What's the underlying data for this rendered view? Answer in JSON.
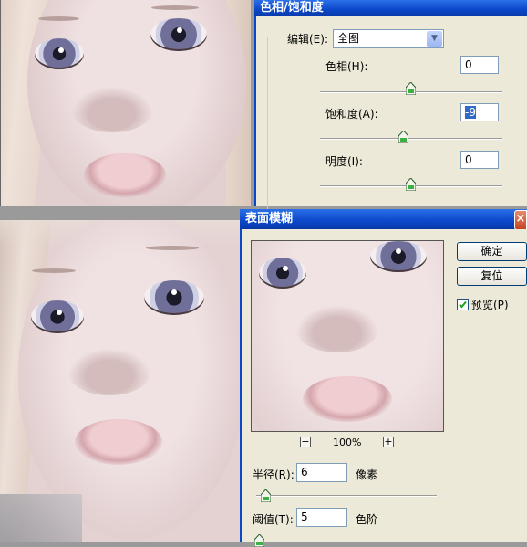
{
  "hue_sat_dialog": {
    "title": "色相/饱和度",
    "edit_label": "编辑(E):",
    "edit_value": "全图",
    "hue_label": "色相(H):",
    "hue_value": "0",
    "saturation_label": "饱和度(A):",
    "saturation_value": "-9",
    "lightness_label": "明度(I):",
    "lightness_value": "0"
  },
  "surface_blur_dialog": {
    "title": "表面模糊",
    "ok_label": "确定",
    "reset_label": "复位",
    "preview_label": "预览(P)",
    "preview_checked": true,
    "zoom_out_label": "−",
    "zoom_in_label": "+",
    "zoom_level": "100%",
    "radius_label": "半径(R):",
    "radius_value": "6",
    "radius_unit": "像素",
    "threshold_label": "阈值(T):",
    "threshold_value": "5",
    "threshold_unit": "色阶",
    "close_label": "×"
  },
  "colors": {
    "title_bar": "#0b47c9",
    "dialog_bg": "#ece9d8",
    "skin": "#e6d2d3"
  }
}
